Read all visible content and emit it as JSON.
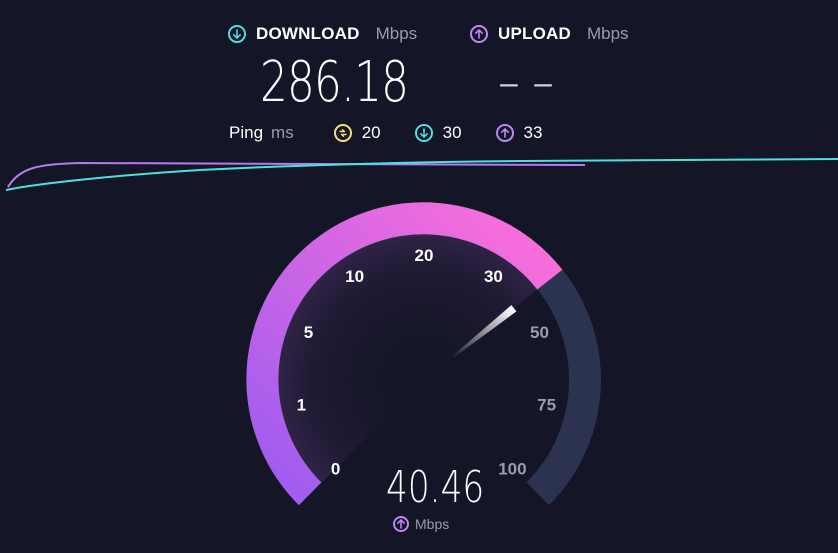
{
  "download": {
    "label": "DOWNLOAD",
    "unit": "Mbps",
    "value": "286.18",
    "icon": "arrow-down-circle-icon",
    "color": "#4fe0dc"
  },
  "upload": {
    "label": "UPLOAD",
    "unit": "Mbps",
    "value": "– –",
    "icon": "arrow-up-circle-icon",
    "color": "#c186f5"
  },
  "ping": {
    "label": "Ping",
    "unit": "ms",
    "jitter": "20",
    "down": "30",
    "up": "33"
  },
  "gauge": {
    "ticks": [
      "0",
      "1",
      "5",
      "10",
      "20",
      "30",
      "50",
      "75",
      "100"
    ],
    "value": 40.46,
    "display_value": "40.46",
    "unit": "Mbps",
    "gradient_start": "#9b5cf0",
    "gradient_end": "#ff6fd9",
    "track_color": "#2b3350"
  }
}
